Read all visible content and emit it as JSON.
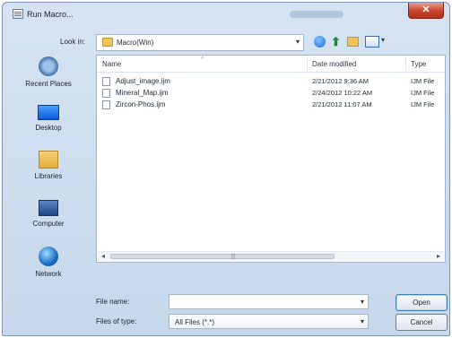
{
  "window": {
    "title": "Run Macro..."
  },
  "title_bar": {
    "close_glyph": "✕"
  },
  "toolbar": {
    "look_in_label": "Look in:",
    "look_in_value": "Macro(Win)",
    "combo_arrow": "▾",
    "up_glyph": "⬆"
  },
  "places": [
    {
      "label": "Recent Places",
      "icon": "recent-places-icon"
    },
    {
      "label": "Desktop",
      "icon": "desktop-icon"
    },
    {
      "label": "Libraries",
      "icon": "libraries-icon"
    },
    {
      "label": "Computer",
      "icon": "computer-icon"
    },
    {
      "label": "Network",
      "icon": "network-icon"
    }
  ],
  "file_list": {
    "columns": {
      "name": "Name",
      "date": "Date modified",
      "type": "Type"
    },
    "sort_caret": "^",
    "rows": [
      {
        "name": "Adjust_image.ijm",
        "date": "2/21/2012 9:36 AM",
        "type": "IJM File"
      },
      {
        "name": "Mineral_Map.ijm",
        "date": "2/24/2012 10:22 AM",
        "type": "IJM File"
      },
      {
        "name": "Zircon-Phos.ijm",
        "date": "2/21/2012 11:07 AM",
        "type": "IJM File"
      }
    ],
    "scroll_left": "◂",
    "scroll_right": "▸",
    "scroll_grip": "⠿"
  },
  "footer": {
    "file_name_label": "File name:",
    "file_name_value": "",
    "files_of_type_label": "Files of type:",
    "files_of_type_value": "All Files (*.*)",
    "open_label": "Open",
    "cancel_label": "Cancel",
    "combo_arrow": "▾"
  }
}
